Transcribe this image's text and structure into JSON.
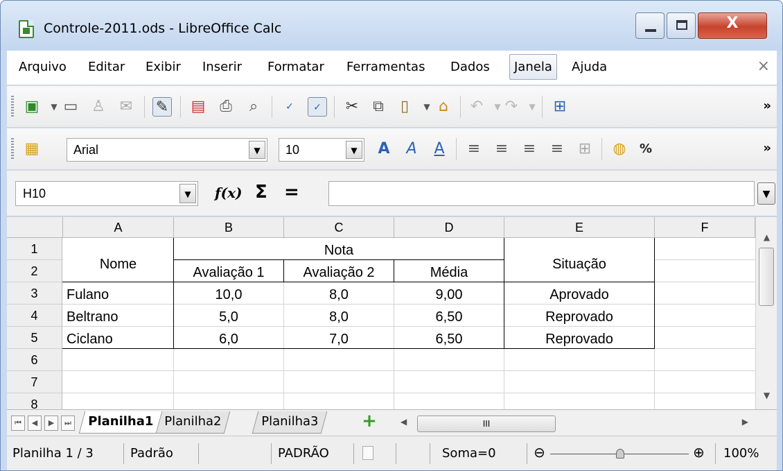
{
  "window": {
    "title": "Controle-2011.ods - LibreOffice Calc",
    "close_glyph": "X"
  },
  "menu": [
    "Arquivo",
    "Editar",
    "Exibir",
    "Inserir",
    "Formatar",
    "Ferramentas",
    "Dados",
    "Janela",
    "Ajuda"
  ],
  "menu_close": "×",
  "format_toolbar": {
    "font_name": "Arial",
    "font_size": "10",
    "percent": "%"
  },
  "toolbar_more": "»",
  "formula_bar": {
    "name_box": "H10",
    "fx": "f(x)",
    "sum": "Σ",
    "equals": "=",
    "formula": ""
  },
  "columns": [
    "A",
    "B",
    "C",
    "D",
    "E",
    "F"
  ],
  "rows": [
    "1",
    "2",
    "3",
    "4",
    "5",
    "6",
    "7",
    "8"
  ],
  "table": {
    "nome_header": "Nome",
    "nota_header": "Nota",
    "situacao_header": "Situação",
    "sub_headers": [
      "Avaliação 1",
      "Avaliação 2",
      "Média"
    ],
    "records": [
      {
        "nome": "Fulano",
        "av1": "10,0",
        "av2": "8,0",
        "media": "9,00",
        "situacao": "Aprovado"
      },
      {
        "nome": "Beltrano",
        "av1": "5,0",
        "av2": "8,0",
        "media": "6,50",
        "situacao": "Reprovado"
      },
      {
        "nome": "Ciclano",
        "av1": "6,0",
        "av2": "7,0",
        "media": "6,50",
        "situacao": "Reprovado"
      }
    ]
  },
  "sheets": [
    "Planilha1",
    "Planilha2",
    "Planilha3"
  ],
  "active_sheet": "Planilha1",
  "hscroll_thumb": "III",
  "status": {
    "sheet": "Planilha 1 / 3",
    "style": "Padrão",
    "mode": "PADRÃO",
    "sum": "Soma=0",
    "zoom": "100%",
    "zoom_minus": "⊖",
    "zoom_plus": "⊕"
  }
}
